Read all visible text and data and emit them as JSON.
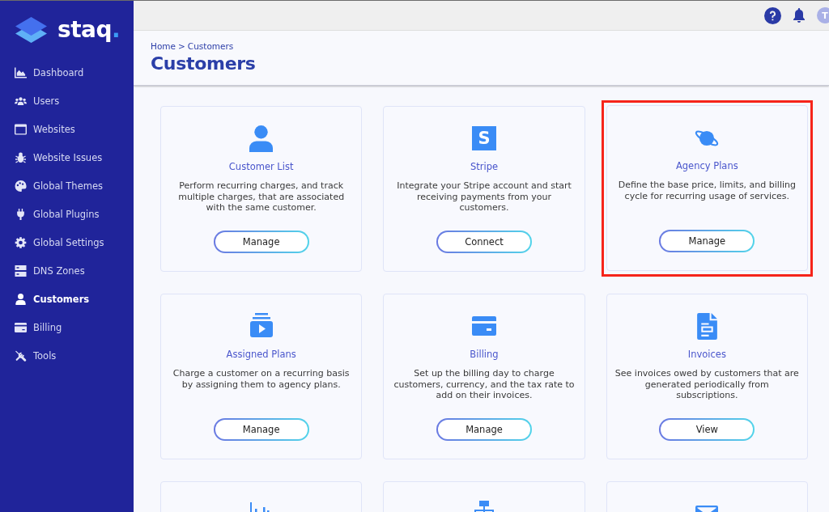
{
  "sidebar": {
    "logo": {
      "text": "staq",
      "accent": "."
    },
    "items": [
      {
        "label": "Dashboard",
        "selected": false
      },
      {
        "label": "Users",
        "selected": false
      },
      {
        "label": "Websites",
        "selected": false
      },
      {
        "label": "Website Issues",
        "selected": false
      },
      {
        "label": "Global Themes",
        "selected": false
      },
      {
        "label": "Global Plugins",
        "selected": false
      },
      {
        "label": "Global Settings",
        "selected": false
      },
      {
        "label": "DNS Zones",
        "selected": false
      },
      {
        "label": "Customers",
        "selected": true
      },
      {
        "label": "Billing",
        "selected": false
      },
      {
        "label": "Tools",
        "selected": false
      }
    ]
  },
  "topbar": {
    "avatar": {
      "initial": "T"
    }
  },
  "header": {
    "breadcrumb": [
      "Home",
      "Customers"
    ],
    "separator": ">",
    "title": "Customers"
  },
  "cards": [
    {
      "partial": false,
      "highlighted": false,
      "title": "Customer List",
      "description": "Perform recurring charges, and track multiple charges, that are associated with the same customer.",
      "button": "Manage"
    },
    {
      "partial": false,
      "highlighted": false,
      "logo_letter": "S",
      "title": "Stripe",
      "description": "Integrate your Stripe account and start receiving payments from your customers.",
      "button": "Connect"
    },
    {
      "partial": false,
      "highlighted": true,
      "title": "Agency Plans",
      "description": "Define the base price, limits, and billing cycle for recurring usage of services.",
      "button": "Manage"
    },
    {
      "partial": false,
      "highlighted": false,
      "title": "Assigned Plans",
      "description": "Charge a customer on a recurring basis by assigning them to agency plans.",
      "button": "Manage"
    },
    {
      "partial": false,
      "highlighted": false,
      "title": "Billing",
      "description": "Set up the billing day to charge customers, currency, and the tax rate to add on their invoices.",
      "button": "Manage"
    },
    {
      "partial": false,
      "highlighted": false,
      "title": "Invoices",
      "description": "See invoices owed by customers that are generated periodically from subscriptions.",
      "button": "View"
    },
    {
      "partial": true,
      "highlighted": false
    },
    {
      "partial": true,
      "highlighted": false
    },
    {
      "partial": true,
      "highlighted": false
    }
  ]
}
